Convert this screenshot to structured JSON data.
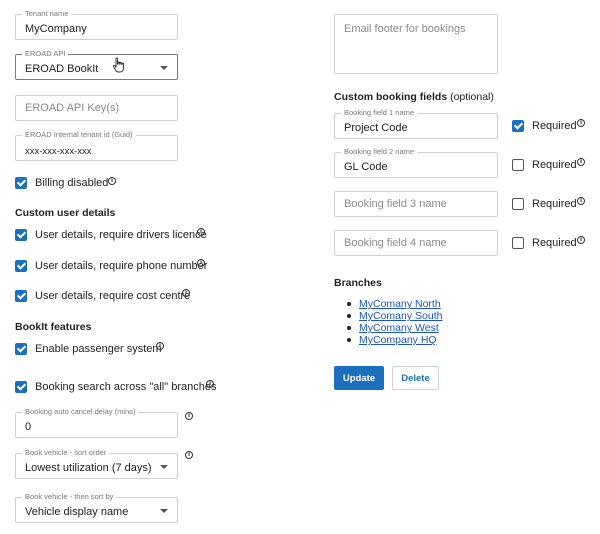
{
  "left": {
    "tenant_name": {
      "label": "Tenant name",
      "value": "MyCompany"
    },
    "eroad_api": {
      "label": "EROAD API",
      "value": "EROAD BookIt"
    },
    "eroad_api_keys": {
      "placeholder": "EROAD API Key(s)"
    },
    "eroad_tenant_id": {
      "label": "EROAD Internal tenant id (Guid)",
      "value": "xxx-xxx-xxx-xxx"
    },
    "billing_disabled": {
      "label": "Billing disabled",
      "checked": true
    },
    "custom_user_details": {
      "heading": "Custom user details",
      "options": [
        {
          "label": "User details, require drivers licence",
          "checked": true
        },
        {
          "label": "User details, require phone number",
          "checked": true
        },
        {
          "label": "User details, require cost centre",
          "checked": true
        }
      ]
    },
    "bookit_features": {
      "heading": "BookIt features",
      "options": [
        {
          "label": "Enable passenger system",
          "checked": true
        },
        {
          "label": "Booking search across \"all\" branches",
          "checked": true
        }
      ]
    },
    "auto_cancel": {
      "label": "Booking auto cancel delay (mins)",
      "value": "0"
    },
    "sort_order": {
      "label": "Book vehicle - sort order",
      "value": "Lowest utilization (7 days)"
    },
    "then_sort_by": {
      "label": "Book vehicle - then sort by",
      "value": "Vehicle display name"
    }
  },
  "right": {
    "email_footer": {
      "placeholder": "Email footer for bookings"
    },
    "custom_booking_fields": {
      "heading": "Custom booking fields",
      "heading_optional": "(optional)",
      "required_label": "Required",
      "fields": [
        {
          "label": "Booking field 1 name",
          "value": "Project Code",
          "placeholder": "",
          "required": true
        },
        {
          "label": "Booking field 2 name",
          "value": "GL Code",
          "placeholder": "",
          "required": false
        },
        {
          "label": "",
          "value": "",
          "placeholder": "Booking field 3 name",
          "required": false
        },
        {
          "label": "",
          "value": "",
          "placeholder": "Booking field 4 name",
          "required": false
        }
      ]
    },
    "branches": {
      "heading": "Branches",
      "items": [
        "MyComany North",
        "MyComany South",
        "MyComany West",
        "MyCompany HQ"
      ]
    },
    "buttons": {
      "update": "Update",
      "delete": "Delete"
    }
  },
  "icons": {
    "info": "info-icon",
    "dropdown": "caret-down-icon",
    "cursor": "hand-pointer-icon"
  },
  "colors": {
    "accent": "#1a6fbf",
    "link": "#1a55c4"
  }
}
